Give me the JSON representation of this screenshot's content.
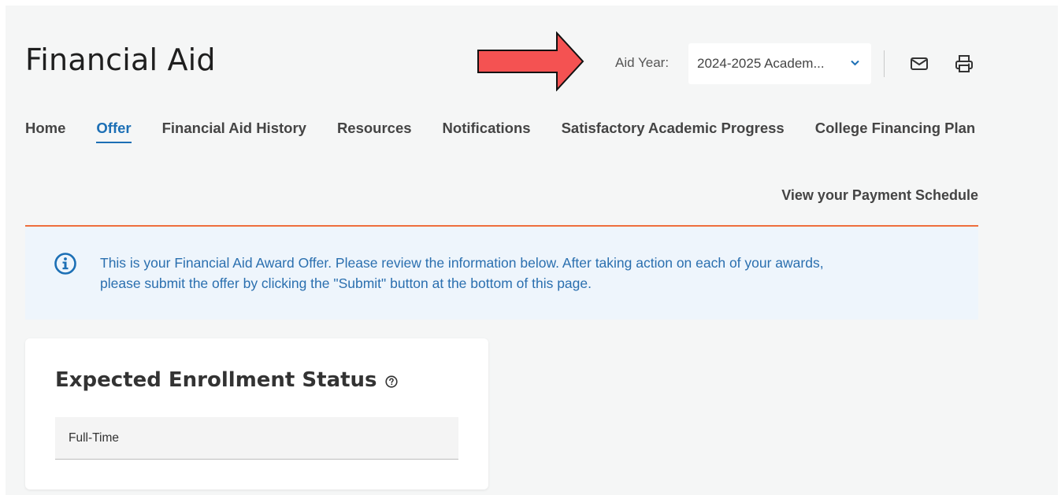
{
  "header": {
    "title": "Financial Aid",
    "aid_year_label": "Aid Year:",
    "aid_year_value": "2024-2025 Academ..."
  },
  "icons": {
    "mail": "mail-icon",
    "print": "printer-icon",
    "chevron": "chevron-down-icon",
    "info": "info-icon",
    "help": "help-icon"
  },
  "nav": {
    "tabs": [
      {
        "label": "Home"
      },
      {
        "label": "Offer",
        "active": true
      },
      {
        "label": "Financial Aid History"
      },
      {
        "label": "Resources"
      },
      {
        "label": "Notifications"
      },
      {
        "label": "Satisfactory Academic Progress"
      },
      {
        "label": "College Financing Plan"
      }
    ]
  },
  "payment_link": "View your Payment Schedule",
  "info": {
    "line1": "This is your Financial Aid Award Offer. Please review the information below. After taking action on each of your awards,",
    "line2": "please submit the offer by clicking the \"Submit\" button at the bottom of this page."
  },
  "enrollment": {
    "title": "Expected Enrollment Status",
    "value": "Full-Time"
  },
  "colors": {
    "accent_blue": "#1c6fb5",
    "accent_orange": "#ee6e3c",
    "arrow_red": "#f45252",
    "info_bg": "#eef5fc"
  }
}
